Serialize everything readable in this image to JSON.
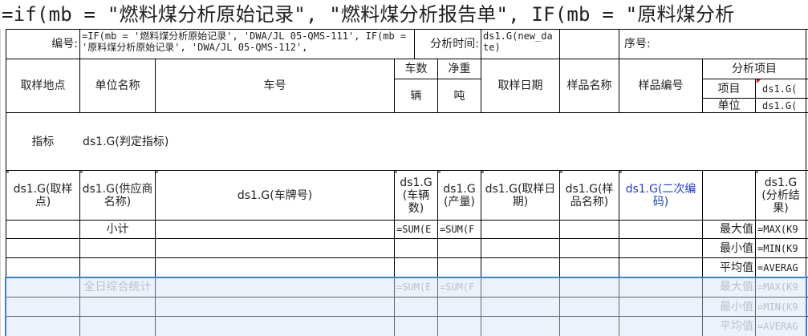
{
  "title": "=if(mb = \"燃料煤分析原始记录\", \"燃料煤分析报告单\", IF(mb = \"原料煤分析",
  "info_row": {
    "bianhao_label": "编号:",
    "bianhao_formula": "=IF(mb = '燃料煤分析原始记录', 'DWA/JL 05-QMS-111', IF(mb = '原料煤分析原始记录', 'DWA/JL 05-QMS-112',",
    "analysis_time_label": "分析时间:",
    "analysis_time_value": "ds1.G(new_date)",
    "serial_label": "序号:"
  },
  "header": {
    "sampling_location": "取样地点",
    "unit_name": "单位名称",
    "car_number": "车号",
    "car_count": "车数",
    "car_count_unit": "辆",
    "net_weight": "净重",
    "net_weight_unit": "吨",
    "sampling_date": "取样日期",
    "sample_name": "样品名称",
    "sample_code": "样品编号",
    "analysis_items": "分析项目",
    "item_label": "项目",
    "unit_label": "单位",
    "item_value": "ds1.G(",
    "unit_value": "ds1.G("
  },
  "indicator_row": {
    "label": "指标",
    "value": "ds1.G(判定指标)"
  },
  "data_row": {
    "sampling_point": "ds1.G(取样点)",
    "supplier": "ds1.G(供应商名称)",
    "plate": "ds1.G(车牌号)",
    "vehicle_count": "ds1.G(车辆数)",
    "output": "ds1.G(产量)",
    "sampling_date": "ds1.G(取样日期)",
    "sample_name": "ds1.G(样品名称)",
    "secondary_code": "ds1.G(二次编码)",
    "result": "ds1.G(分析结果)"
  },
  "subtotal": {
    "label": "小计",
    "sum_e": "=SUM(E",
    "sum_f": "=SUM(F",
    "max_label": "最大值",
    "min_label": "最小值",
    "avg_label": "平均值",
    "max_formula": "=MAX(K9",
    "min_formula": "=MIN(K9",
    "avg_formula": "=AVERAG"
  },
  "daily": {
    "label": "全日综合统计",
    "sum_e": "=SUM(E",
    "sum_f": "=SUM(F",
    "max_label": "最大值",
    "min_label": "最小值",
    "avg_label": "平均值",
    "max_formula": "=MAX(K9",
    "min_formula": "=MIN(K9",
    "avg_formula": "=AVERAG"
  },
  "colors": {
    "grid_line": "#000000",
    "selection_border": "#3d7fe0",
    "selection_fill": "#d2e2f6",
    "link_blue": "#1f3cc9",
    "muted_text": "#a7a7a7"
  }
}
